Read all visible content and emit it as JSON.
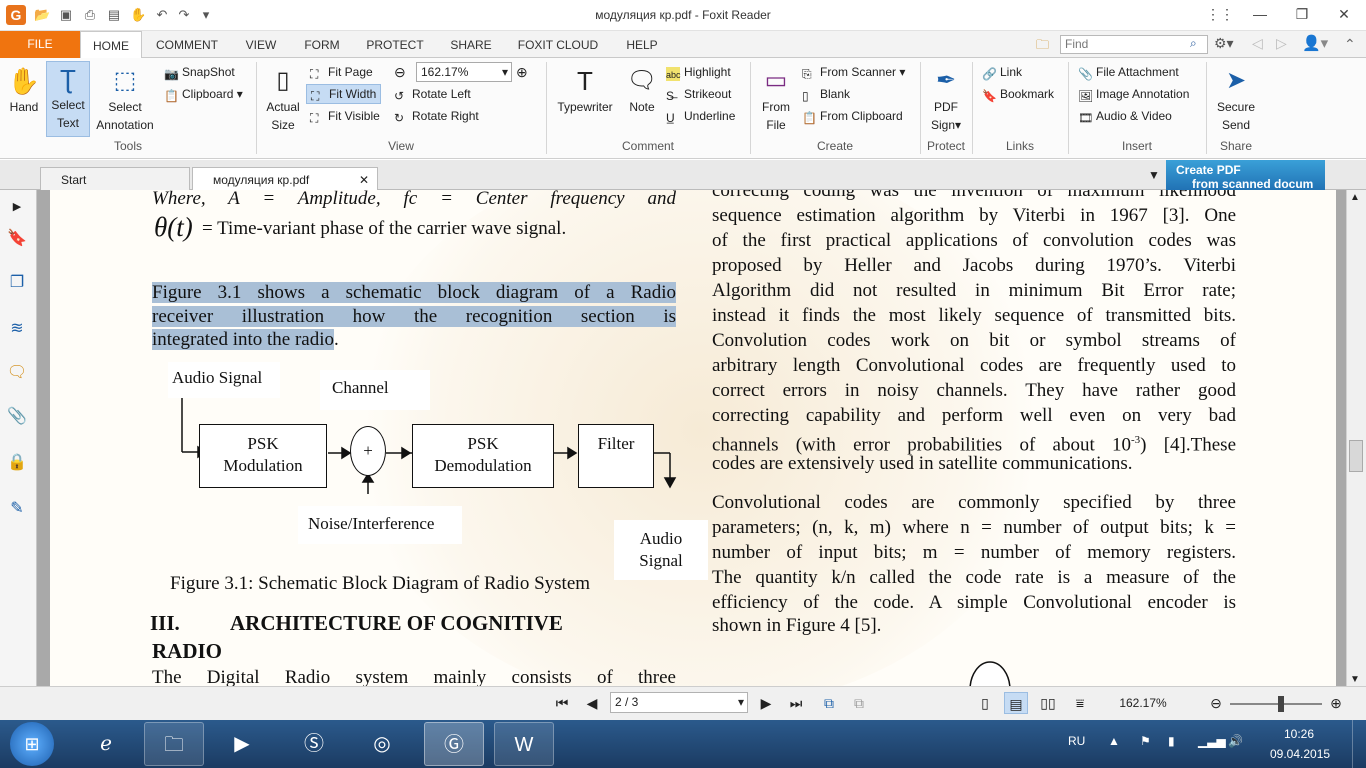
{
  "window": {
    "title": "модуляция кр.pdf - Foxit Reader",
    "min_icon": "minimize-icon",
    "max_icon": "maximize-icon",
    "close_icon": "close-icon"
  },
  "menu": {
    "file": "FILE",
    "tabs": [
      "HOME",
      "COMMENT",
      "VIEW",
      "FORM",
      "PROTECT",
      "SHARE",
      "FOXIT CLOUD",
      "HELP"
    ],
    "find_placeholder": "Find"
  },
  "ribbon": {
    "tools": {
      "hand": "Hand",
      "select_text_1": "Select",
      "select_text_2": "Text",
      "select_ann_1": "Select",
      "select_ann_2": "Annotation",
      "snapshot": "SnapShot",
      "clipboard": "Clipboard",
      "label": "Tools"
    },
    "view": {
      "actual_1": "Actual",
      "actual_2": "Size",
      "fit_page": "Fit Page",
      "fit_width": "Fit Width",
      "fit_visible": "Fit Visible",
      "zoom_value": "162.17%",
      "rotate_left": "Rotate Left",
      "rotate_right": "Rotate Right",
      "label": "View"
    },
    "comment": {
      "typewriter": "Typewriter",
      "note": "Note",
      "highlight": "Highlight",
      "strikeout": "Strikeout",
      "underline": "Underline",
      "label": "Comment"
    },
    "create": {
      "from_file_1": "From",
      "from_file_2": "File",
      "from_scanner": "From Scanner",
      "blank": "Blank",
      "from_clipboard": "From Clipboard",
      "label": "Create"
    },
    "protect": {
      "pdf_sign_1": "PDF",
      "pdf_sign_2": "Sign",
      "label": "Protect"
    },
    "links": {
      "link": "Link",
      "bookmark": "Bookmark",
      "label": "Links"
    },
    "insert": {
      "file_attachment": "File Attachment",
      "image_annotation": "Image Annotation",
      "audio_video": "Audio & Video",
      "label": "Insert"
    },
    "share": {
      "secure_1": "Secure",
      "secure_2": "Send",
      "label": "Share"
    }
  },
  "doc_tabs": {
    "start": "Start",
    "doc": "модуляция кр.pdf",
    "banner_1": "Create PDF",
    "banner_2": "from scanned docum"
  },
  "document": {
    "left_col": {
      "line0": "Where,  A  =  Amplitude,  fc  =  Center  frequency  and",
      "theta": "θ(t)",
      "line1": " = Time-variant phase of the carrier wave signal.",
      "p1": [
        "Figure 3.1 shows a schematic block diagram of a Radio",
        "receiver illustration how the recognition section is",
        "integrated into the radio"
      ],
      "p1_end": ".",
      "diagram": {
        "audio_in": "Audio Signal",
        "channel": "Channel",
        "psk_mod": [
          "PSK",
          "Modulation"
        ],
        "plus": "+",
        "psk_demod": [
          "PSK",
          "Demodulation"
        ],
        "filter": "Filter",
        "noise": "Noise/Interference",
        "audio_out": [
          "Audio",
          "Signal"
        ]
      },
      "caption": "Figure 3.1:   Schematic Block Diagram of Radio System",
      "heading_num": "III.",
      "heading": "ARCHITECTURE OF COGNITIVE",
      "heading2": "RADIO",
      "p2": "The  Digital  Radio  system  mainly  consists  of  three"
    },
    "right_col": {
      "lines": [
        "correcting coding was the invention of maximum likelihood",
        "sequence estimation algorithm by Viterbi in 1967 [3].  One",
        "of the first practical applications of convolution codes was",
        "proposed by Heller and Jacobs during 1970’s. Viterbi",
        "Algorithm did not resulted in minimum Bit Error rate;",
        "instead it finds the most likely sequence of transmitted bits.",
        "Convolution codes work on bit or symbol streams of",
        "arbitrary length Convolutional codes are frequently used to",
        "correct errors in noisy channels. They have rather good",
        "correcting capability and perform well even on very bad"
      ],
      "line_exp_a": "channels (with error probabilities of about 10",
      "line_exp_sup": "-3",
      "line_exp_b": ") [4].These",
      "line_last": "codes are extensively used in satellite communications.",
      "p2": [
        "Convolutional codes are commonly specified by three",
        "parameters; (n, k, m) where n = number of output bits;      k =",
        "number of input bits;      m = number of memory registers.",
        "The quantity k/n called the code rate is a measure of the",
        "efficiency of the code. A simple Convolutional encoder is"
      ],
      "p2_last": "shown in Figure 4 [5]."
    }
  },
  "status": {
    "page": "2 / 3",
    "zoom": "162.17%"
  },
  "taskbar": {
    "lang": "RU",
    "time": "10:26",
    "date": "09.04.2015"
  }
}
